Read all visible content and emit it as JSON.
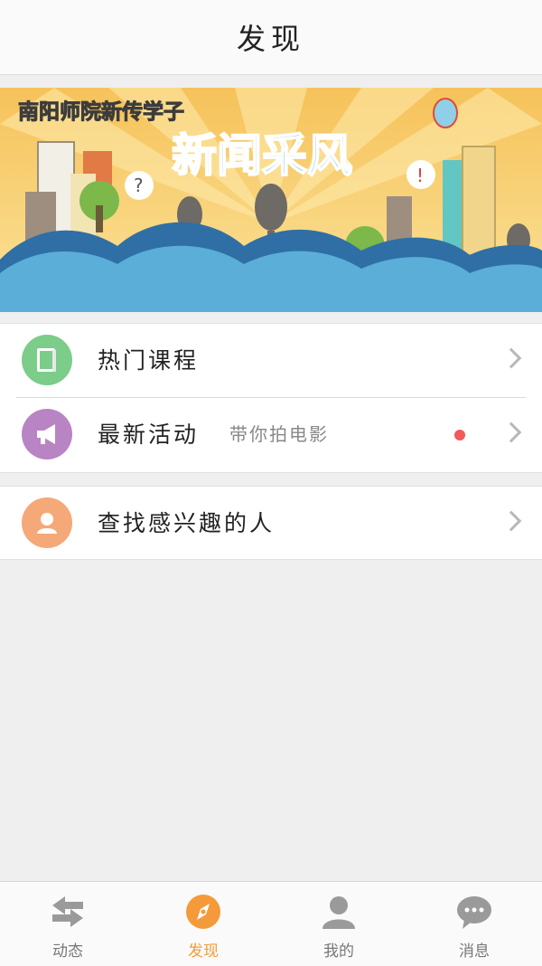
{
  "header": {
    "title": "发现"
  },
  "banner": {
    "tagline": "南阳师院新传学子",
    "headline": "新闻采风"
  },
  "menu": {
    "hot_courses": {
      "label": "热门课程",
      "icon": "book-icon",
      "color": "#7ccc8a"
    },
    "latest_events": {
      "label": "最新活动",
      "sub": "带你拍电影",
      "icon": "megaphone-icon",
      "color": "#b884c4",
      "badge_color": "#f25a5a"
    },
    "find_people": {
      "label": "查找感兴趣的人",
      "icon": "person-icon",
      "color": "#f5a878"
    }
  },
  "tabbar": {
    "active": "发现",
    "active_color": "#f59a3a",
    "items": [
      {
        "label": "动态",
        "icon": "swap-arrows-icon"
      },
      {
        "label": "发现",
        "icon": "compass-icon"
      },
      {
        "label": "我的",
        "icon": "person-icon"
      },
      {
        "label": "消息",
        "icon": "chat-bubble-icon"
      }
    ]
  }
}
